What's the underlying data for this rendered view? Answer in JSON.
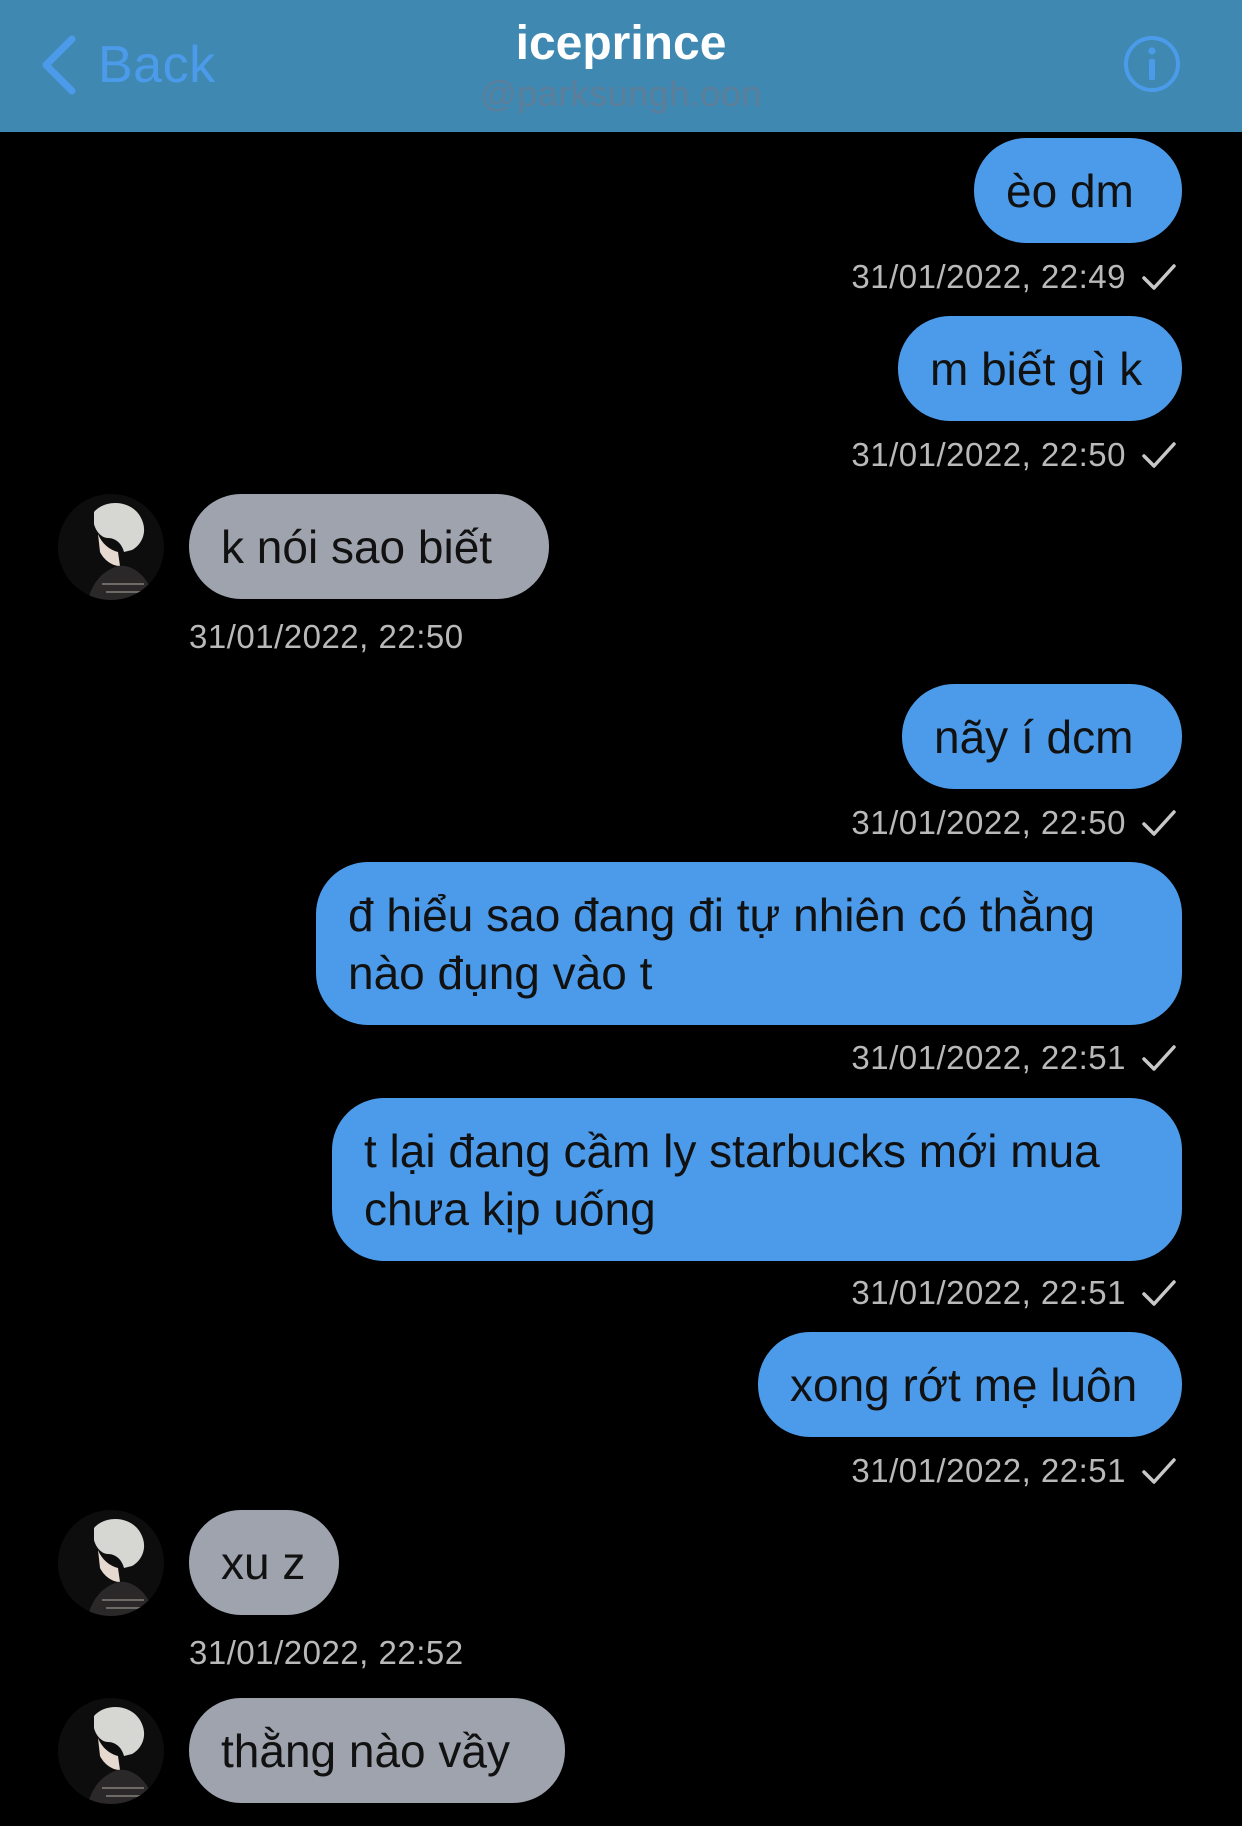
{
  "header": {
    "back_label": "Back",
    "title": "iceprince",
    "subtitle": "@parksungh.oon",
    "back_icon": "chevron-left-icon",
    "info_icon": "info-icon"
  },
  "colors": {
    "header_bg": "#3f88b2",
    "accent": "#4c9bea",
    "outgoing_bubble": "#4c9bea",
    "incoming_bubble": "#9ea3ad",
    "background": "#000000",
    "timestamp": "#b9b9b9"
  },
  "messages": [
    {
      "direction": "out",
      "text": "èo dm",
      "timestamp": "31/01/2022, 22:49",
      "read": true
    },
    {
      "direction": "out",
      "text": "m biết gì k",
      "timestamp": "31/01/2022, 22:50",
      "read": true
    },
    {
      "direction": "in",
      "text": "k nói sao biết",
      "timestamp": "31/01/2022, 22:50"
    },
    {
      "direction": "out",
      "text": "nãy í dcm",
      "timestamp": "31/01/2022, 22:50",
      "read": true
    },
    {
      "direction": "out",
      "text": "đ hiểu sao đang đi tự nhiên có thằng nào đụng vào t",
      "timestamp": "31/01/2022, 22:51",
      "read": true
    },
    {
      "direction": "out",
      "text": "t lại đang cầm ly starbucks mới mua chưa kịp uống",
      "timestamp": "31/01/2022, 22:51",
      "read": true
    },
    {
      "direction": "out",
      "text": "xong rớt mẹ luôn",
      "timestamp": "31/01/2022, 22:51",
      "read": true
    },
    {
      "direction": "in",
      "text": "xu z",
      "timestamp": "31/01/2022, 22:52"
    },
    {
      "direction": "in",
      "text": "thằng nào vầy"
    }
  ]
}
